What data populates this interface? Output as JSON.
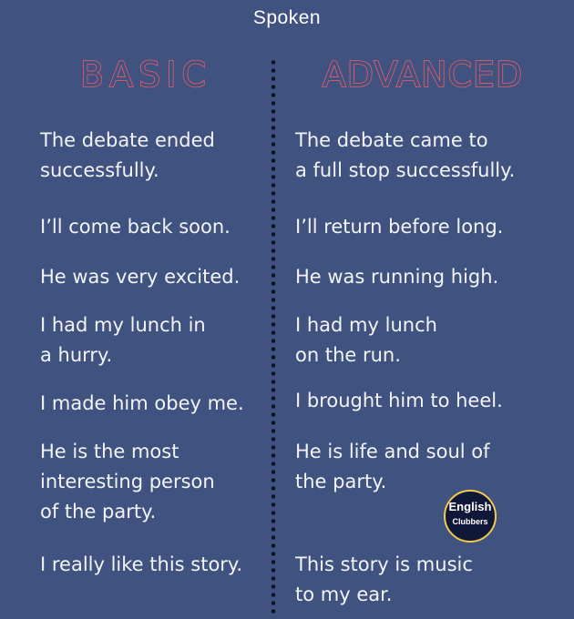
{
  "title": "Spoken",
  "headings": {
    "basic": "BASIC",
    "advanced": "ADVANCED"
  },
  "pairs": [
    {
      "basic": [
        "The debate ended",
        "successfully."
      ],
      "advanced": [
        "The debate came to",
        "a full stop successfully."
      ]
    },
    {
      "basic": [
        "I’ll come back soon."
      ],
      "advanced": [
        "I’ll return before long."
      ]
    },
    {
      "basic": [
        "He was very excited."
      ],
      "advanced": [
        "He was running high."
      ]
    },
    {
      "basic": [
        "I had my lunch in",
        "a hurry."
      ],
      "advanced": [
        "I had my lunch",
        "on the run."
      ]
    },
    {
      "basic": [
        "I made him obey me."
      ],
      "advanced": [
        "I brought him to heel."
      ]
    },
    {
      "basic": [
        "He is the most",
        "interesting person",
        "of the party."
      ],
      "advanced": [
        "He is life and soul of",
        "the party."
      ]
    },
    {
      "basic": [
        "I really like this story."
      ],
      "advanced": [
        "This story is music",
        "to my ear."
      ]
    }
  ],
  "logo": {
    "main": "English",
    "sub": "Clubbers"
  },
  "colors": {
    "background": "#3f5280",
    "heading_outline": "#f05c62",
    "text": "#f3f4f7",
    "divider_dots": "#0d1222",
    "logo_ring": "#f2c94c"
  }
}
